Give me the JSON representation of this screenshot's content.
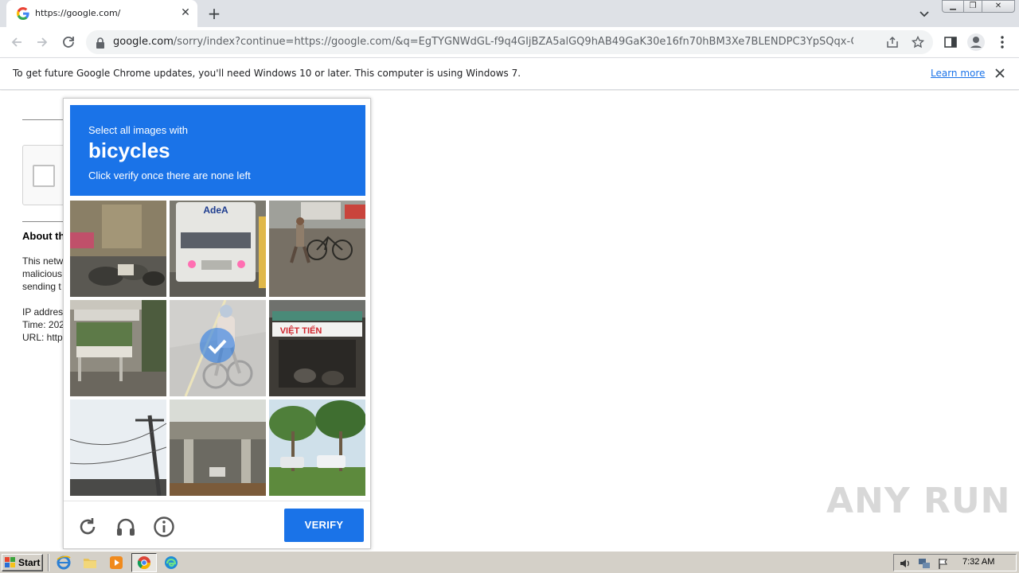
{
  "browser": {
    "tab": {
      "title": "https://google.com/",
      "favicon": "google-g-icon"
    },
    "address": {
      "host": "google.com",
      "path": "/sorry/index?continue=https://google.com/&q=EgTYGNWdGL-f9q4GIjBZA5alGQ9hAB49GaK30e16fn70hBM3Xe7BLENDPC3YpSQqx-OaW6xwL..."
    },
    "window_controls": {
      "minimize": "minimize-icon",
      "maximize": "restore-icon",
      "close": "close-icon"
    }
  },
  "infobar": {
    "message": "To get future Google Chrome updates, you'll need Windows 10 or later. This computer is using Windows 7.",
    "link": "Learn more"
  },
  "background_page": {
    "heading": "About th",
    "paragraph_lines": [
      "This netw",
      "malicious",
      "sending t"
    ],
    "detail_lines": [
      "IP addres",
      "Time: 202",
      "URL: http"
    ]
  },
  "challenge": {
    "line1": "Select all images with",
    "keyword": "bicycles",
    "line2": "Click verify once there are none left",
    "tiles": [
      {
        "scene": "street with parked motorbikes and shops",
        "selected": false
      },
      {
        "scene": "white delivery truck",
        "selected": false
      },
      {
        "scene": "person walking next to bicycle",
        "selected": false
      },
      {
        "scene": "building with balcony and plants",
        "selected": false
      },
      {
        "scene": "cyclist on road",
        "selected": true
      },
      {
        "scene": "shopfront with sign",
        "selected": false
      },
      {
        "scene": "utility pole against sky",
        "selected": false
      },
      {
        "scene": "overpass bridge",
        "selected": false
      },
      {
        "scene": "palm trees and parked cars",
        "selected": false
      }
    ],
    "shop_sign": "VIỆT TIẾN",
    "truck_sign": "AdeA",
    "verify_label": "VERIFY",
    "footer_icons": [
      "reload-icon",
      "audio-headphones-icon",
      "info-icon"
    ]
  },
  "watermark": "ANY RUN",
  "taskbar": {
    "start_label": "Start",
    "clock": "7:32 AM"
  },
  "colors": {
    "accent": "#1a73e8",
    "chrome_frame": "#dee1e6",
    "taskbar": "#d4d0c8"
  }
}
